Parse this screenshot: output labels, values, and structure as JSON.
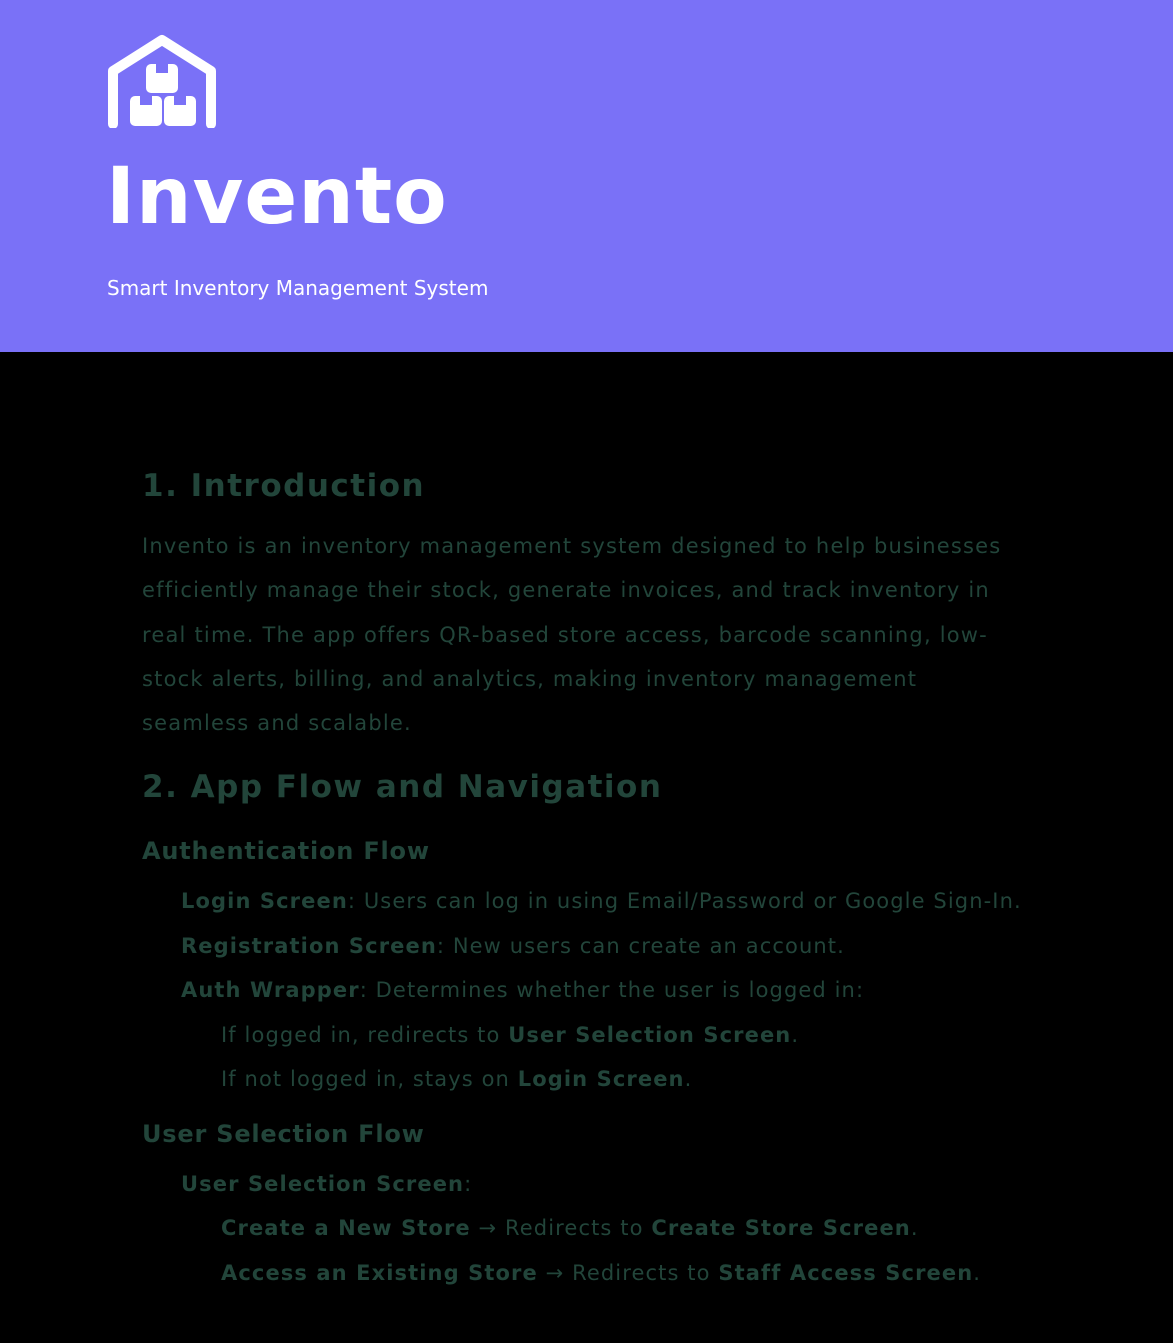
{
  "header": {
    "logo_icon": "warehouse-boxes-icon",
    "title": "Invento",
    "tagline": "Smart Inventory Management System",
    "background": "#7a71f7"
  },
  "sections": {
    "intro": {
      "heading": "1. Introduction",
      "body": "Invento is an inventory management system designed to help businesses efficiently manage their stock, generate invoices, and track inventory in real time. The app offers QR-based store access, barcode scanning, low-stock alerts, billing, and analytics, making inventory management seamless and scalable."
    },
    "flow": {
      "heading": "2. App Flow and Navigation",
      "auth": {
        "heading": "Authentication Flow",
        "login": {
          "term": "Login Screen",
          "desc": ": Users can log in using Email/Password or Google Sign-In."
        },
        "registration": {
          "term": "Registration Screen",
          "desc": ": New users can create an account."
        },
        "wrapper": {
          "term": "Auth Wrapper",
          "desc": ": Determines whether the user is logged in:",
          "logged_in": {
            "prefix": "If logged in, redirects to ",
            "target": "User Selection Screen",
            "suffix": "."
          },
          "not_logged_in": {
            "prefix": "If not logged in, stays on ",
            "target": "Login Screen",
            "suffix": "."
          }
        }
      },
      "user_selection": {
        "heading": "User Selection Flow",
        "screen": {
          "term": "User Selection Screen",
          "desc": ":"
        },
        "create": {
          "term": "Create a New Store",
          "mid": " → Redirects to ",
          "target": "Create Store Screen",
          "suffix": "."
        },
        "access": {
          "term": "Access an Existing Store",
          "mid": " → Redirects to ",
          "target": "Staff Access Screen",
          "suffix": "."
        }
      }
    }
  }
}
